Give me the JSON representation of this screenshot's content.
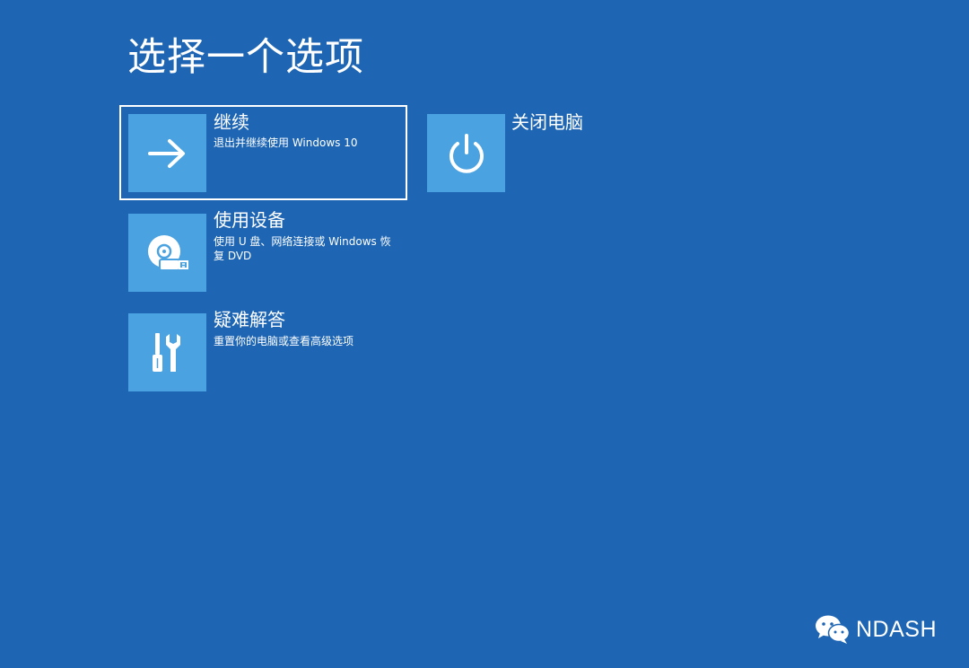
{
  "page": {
    "title": "选择一个选项"
  },
  "options": [
    {
      "title": "继续",
      "description": "退出并继续使用 Windows 10",
      "icon": "arrow-right-icon",
      "selected": true
    },
    {
      "title": "关闭电脑",
      "description": "",
      "icon": "power-icon",
      "selected": false
    },
    {
      "title": "使用设备",
      "description": "使用 U 盘、网络连接或 Windows 恢复 DVD",
      "icon": "disc-usb-icon",
      "selected": false
    },
    {
      "title": "疑难解答",
      "description": "重置你的电脑或查看高级选项",
      "icon": "tools-icon",
      "selected": false
    }
  ],
  "watermark": {
    "text": "NDASH",
    "icon": "wechat-icon"
  },
  "colors": {
    "background": "#1e66b4",
    "tile": "#4aa3e0",
    "text": "#ffffff"
  }
}
